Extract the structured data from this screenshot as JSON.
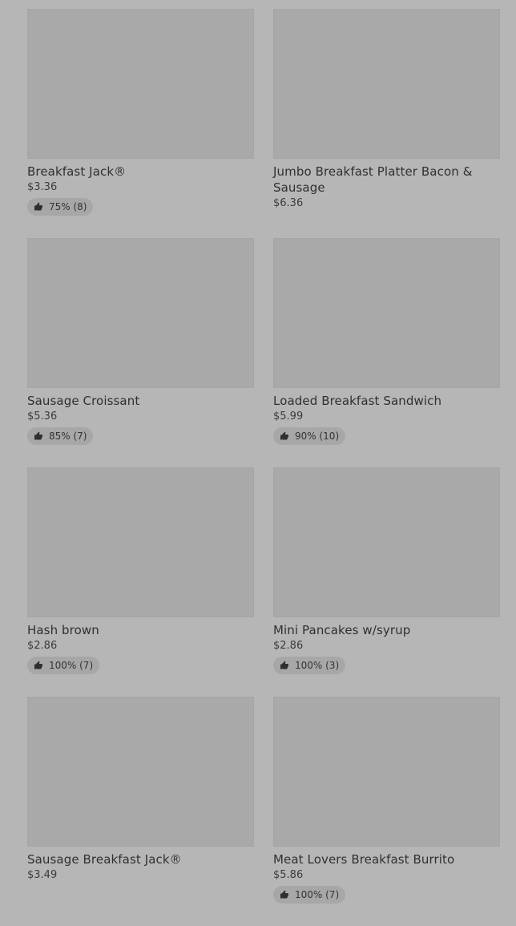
{
  "items": [
    {
      "name": "Breakfast Jack®",
      "price": "$3.36",
      "rating": "75% (8)"
    },
    {
      "name": "Jumbo Breakfast Platter Bacon & Sausage",
      "price": "$6.36",
      "rating": ""
    },
    {
      "name": "Sausage Croissant",
      "price": "$5.36",
      "rating": "85% (7)"
    },
    {
      "name": "Loaded Breakfast Sandwich",
      "price": "$5.99",
      "rating": "90% (10)"
    },
    {
      "name": "Hash brown",
      "price": "$2.86",
      "rating": "100% (7)"
    },
    {
      "name": "Mini Pancakes w/syrup",
      "price": "$2.86",
      "rating": "100% (3)"
    },
    {
      "name": "Sausage Breakfast Jack®",
      "price": "$3.49",
      "rating": ""
    },
    {
      "name": "Meat Lovers Breakfast Burrito",
      "price": "$5.86",
      "rating": "100% (7)"
    }
  ],
  "icons": {
    "rating": "thumbs-up-icon"
  },
  "colors": {
    "background": "#b6b6b6",
    "image_placeholder": "#a9a9a9",
    "rating_pill": "#a7a7a7",
    "text": "#333333"
  }
}
